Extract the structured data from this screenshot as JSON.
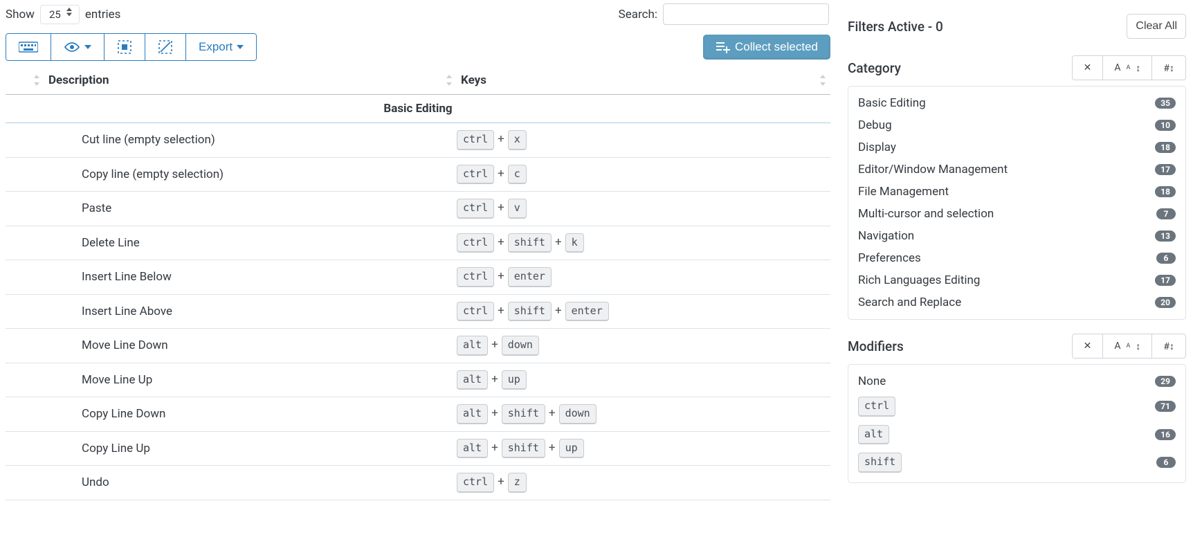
{
  "top": {
    "show_label_pre": "Show",
    "show_value": "25",
    "show_label_post": "entries",
    "search_label": "Search:",
    "search_value": "",
    "export_label": "Export",
    "collect_label": "Collect selected"
  },
  "table": {
    "col_desc": "Description",
    "col_keys": "Keys",
    "group_header": "Basic Editing",
    "rows": [
      {
        "desc": "Cut line (empty selection)",
        "keys": [
          "ctrl",
          "x"
        ]
      },
      {
        "desc": "Copy line (empty selection)",
        "keys": [
          "ctrl",
          "c"
        ]
      },
      {
        "desc": "Paste",
        "keys": [
          "ctrl",
          "v"
        ]
      },
      {
        "desc": "Delete Line",
        "keys": [
          "ctrl",
          "shift",
          "k"
        ]
      },
      {
        "desc": "Insert Line Below",
        "keys": [
          "ctrl",
          "enter"
        ]
      },
      {
        "desc": "Insert Line Above",
        "keys": [
          "ctrl",
          "shift",
          "enter"
        ]
      },
      {
        "desc": "Move Line Down",
        "keys": [
          "alt",
          "down"
        ]
      },
      {
        "desc": "Move Line Up",
        "keys": [
          "alt",
          "up"
        ]
      },
      {
        "desc": "Copy Line Down",
        "keys": [
          "alt",
          "shift",
          "down"
        ]
      },
      {
        "desc": "Copy Line Up",
        "keys": [
          "alt",
          "shift",
          "up"
        ]
      },
      {
        "desc": "Undo",
        "keys": [
          "ctrl",
          "z"
        ]
      }
    ]
  },
  "sidebar": {
    "filters_active_label": "Filters Active - 0",
    "clear_all": "Clear All",
    "category_title": "Category",
    "modifiers_title": "Modifiers",
    "categories": [
      {
        "name": "Basic Editing",
        "count": "35"
      },
      {
        "name": "Debug",
        "count": "10"
      },
      {
        "name": "Display",
        "count": "18"
      },
      {
        "name": "Editor/Window Management",
        "count": "17"
      },
      {
        "name": "File Management",
        "count": "18"
      },
      {
        "name": "Multi-cursor and selection",
        "count": "7"
      },
      {
        "name": "Navigation",
        "count": "13"
      },
      {
        "name": "Preferences",
        "count": "6"
      },
      {
        "name": "Rich Languages Editing",
        "count": "17"
      },
      {
        "name": "Search and Replace",
        "count": "20"
      }
    ],
    "modifiers": [
      {
        "name": "None",
        "count": "29",
        "kbd": false
      },
      {
        "name": "ctrl",
        "count": "71",
        "kbd": true
      },
      {
        "name": "alt",
        "count": "16",
        "kbd": true
      },
      {
        "name": "shift",
        "count": "6",
        "kbd": true
      }
    ]
  }
}
